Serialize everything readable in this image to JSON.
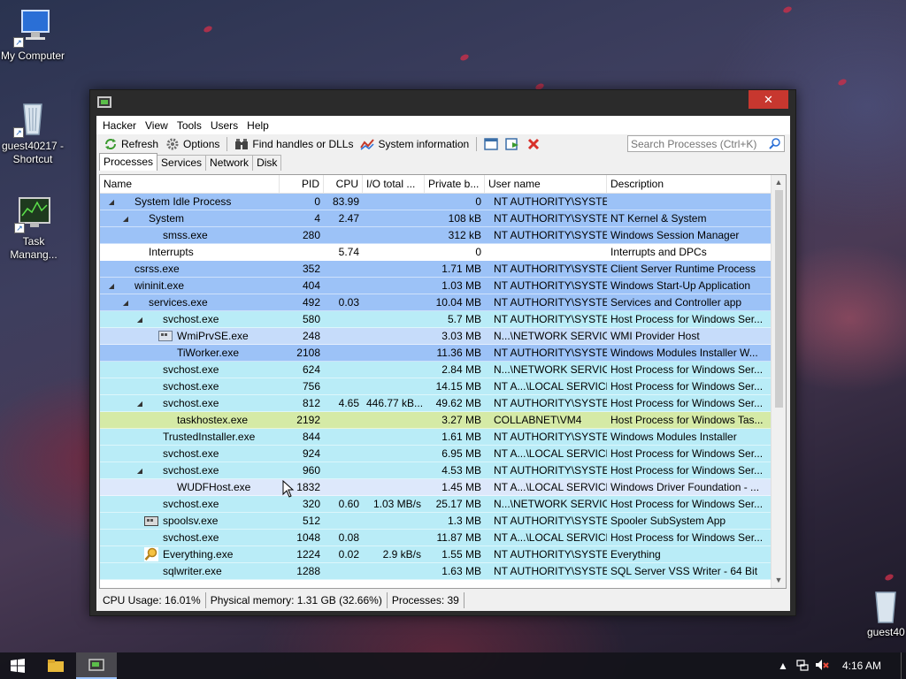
{
  "desktop": {
    "icons": [
      {
        "label": "My Computer"
      },
      {
        "label": "guest40217 - Shortcut"
      },
      {
        "label": "Task Manang..."
      },
      {
        "label": "guest40"
      }
    ]
  },
  "window": {
    "close_glyph": "✕",
    "menu": [
      "Hacker",
      "View",
      "Tools",
      "Users",
      "Help"
    ],
    "toolbar": {
      "refresh": "Refresh",
      "options": "Options",
      "find_handles": "Find handles or DLLs",
      "system_info": "System information",
      "search_placeholder": "Search Processes (Ctrl+K)"
    },
    "tabs": [
      "Processes",
      "Services",
      "Network",
      "Disk"
    ],
    "columns": {
      "name": "Name",
      "pid": "PID",
      "cpu": "CPU",
      "io": "I/O total ...",
      "private": "Private b...",
      "user": "User name",
      "description": "Description"
    },
    "processes": [
      {
        "name": "System Idle Process",
        "indent": 0,
        "expander": "◢",
        "icon": "window",
        "pid": "0",
        "cpu": "83.99",
        "io": "",
        "private": "0",
        "user": "NT AUTHORITY\\SYSTEM",
        "description": "",
        "color": "#9cc2f7"
      },
      {
        "name": "System",
        "indent": 1,
        "expander": "◢",
        "icon": "window",
        "pid": "4",
        "cpu": "2.47",
        "io": "",
        "private": "108 kB",
        "user": "NT AUTHORITY\\SYSTEM",
        "description": "NT Kernel & System",
        "color": "#9cc2f7"
      },
      {
        "name": "smss.exe",
        "indent": 2,
        "expander": "",
        "icon": "window",
        "pid": "280",
        "cpu": "",
        "io": "",
        "private": "312 kB",
        "user": "NT AUTHORITY\\SYSTEM",
        "description": "Windows Session Manager",
        "color": "#9cc2f7"
      },
      {
        "name": "Interrupts",
        "indent": 1,
        "expander": "",
        "icon": "window",
        "pid": "",
        "cpu": "5.74",
        "io": "",
        "private": "0",
        "user": "",
        "description": "Interrupts and DPCs",
        "color": "#ffffff"
      },
      {
        "name": "csrss.exe",
        "indent": 0,
        "expander": "",
        "icon": "window",
        "pid": "352",
        "cpu": "",
        "io": "",
        "private": "1.71 MB",
        "user": "NT AUTHORITY\\SYSTEM",
        "description": "Client Server Runtime Process",
        "color": "#9cc2f7"
      },
      {
        "name": "wininit.exe",
        "indent": 0,
        "expander": "◢",
        "icon": "window",
        "pid": "404",
        "cpu": "",
        "io": "",
        "private": "1.03 MB",
        "user": "NT AUTHORITY\\SYSTEM",
        "description": "Windows Start-Up Application",
        "color": "#9cc2f7"
      },
      {
        "name": "services.exe",
        "indent": 1,
        "expander": "◢",
        "icon": "window",
        "pid": "492",
        "cpu": "0.03",
        "io": "",
        "private": "10.04 MB",
        "user": "NT AUTHORITY\\SYSTEM",
        "description": "Services and Controller app",
        "color": "#9cc2f7"
      },
      {
        "name": "svchost.exe",
        "indent": 2,
        "expander": "◢",
        "icon": "window",
        "pid": "580",
        "cpu": "",
        "io": "",
        "private": "5.7 MB",
        "user": "NT AUTHORITY\\SYSTEM",
        "description": "Host Process for Windows Ser...",
        "color": "#b9ecf7"
      },
      {
        "name": "WmiPrvSE.exe",
        "indent": 3,
        "expander": "",
        "icon": "gear",
        "pid": "248",
        "cpu": "",
        "io": "",
        "private": "3.03 MB",
        "user": "N...\\NETWORK SERVICE",
        "description": "WMI Provider Host",
        "color": "#c6dcfa"
      },
      {
        "name": "TiWorker.exe",
        "indent": 3,
        "expander": "",
        "icon": "window",
        "pid": "2108",
        "cpu": "",
        "io": "",
        "private": "11.36 MB",
        "user": "NT AUTHORITY\\SYSTEM",
        "description": "Windows Modules Installer W...",
        "color": "#9cc2f7"
      },
      {
        "name": "svchost.exe",
        "indent": 2,
        "expander": "",
        "icon": "window",
        "pid": "624",
        "cpu": "",
        "io": "",
        "private": "2.84 MB",
        "user": "N...\\NETWORK SERVICE",
        "description": "Host Process for Windows Ser...",
        "color": "#b9ecf7"
      },
      {
        "name": "svchost.exe",
        "indent": 2,
        "expander": "",
        "icon": "window",
        "pid": "756",
        "cpu": "",
        "io": "",
        "private": "14.15 MB",
        "user": "NT A...\\LOCAL SERVICE",
        "description": "Host Process for Windows Ser...",
        "color": "#b9ecf7"
      },
      {
        "name": "svchost.exe",
        "indent": 2,
        "expander": "◢",
        "icon": "window",
        "pid": "812",
        "cpu": "4.65",
        "io": "446.77 kB...",
        "private": "49.62 MB",
        "user": "NT AUTHORITY\\SYSTEM",
        "description": "Host Process for Windows Ser...",
        "color": "#b9ecf7"
      },
      {
        "name": "taskhostex.exe",
        "indent": 3,
        "expander": "",
        "icon": "window",
        "pid": "2192",
        "cpu": "",
        "io": "",
        "private": "3.27 MB",
        "user": "COLLABNET\\VM4",
        "description": "Host Process for Windows Tas...",
        "color": "#d5eaa6"
      },
      {
        "name": "TrustedInstaller.exe",
        "indent": 2,
        "expander": "",
        "icon": "window",
        "pid": "844",
        "cpu": "",
        "io": "",
        "private": "1.61 MB",
        "user": "NT AUTHORITY\\SYSTEM",
        "description": "Windows Modules Installer",
        "color": "#b9ecf7"
      },
      {
        "name": "svchost.exe",
        "indent": 2,
        "expander": "",
        "icon": "window",
        "pid": "924",
        "cpu": "",
        "io": "",
        "private": "6.95 MB",
        "user": "NT A...\\LOCAL SERVICE",
        "description": "Host Process for Windows Ser...",
        "color": "#b9ecf7"
      },
      {
        "name": "svchost.exe",
        "indent": 2,
        "expander": "◢",
        "icon": "window",
        "pid": "960",
        "cpu": "",
        "io": "",
        "private": "4.53 MB",
        "user": "NT AUTHORITY\\SYSTEM",
        "description": "Host Process for Windows Ser...",
        "color": "#b9ecf7"
      },
      {
        "name": "WUDFHost.exe",
        "indent": 3,
        "expander": "",
        "icon": "window",
        "pid": "1832",
        "cpu": "",
        "io": "",
        "private": "1.45 MB",
        "user": "NT A...\\LOCAL SERVICE",
        "description": "Windows Driver Foundation - ...",
        "color": "#dde8fb"
      },
      {
        "name": "svchost.exe",
        "indent": 2,
        "expander": "",
        "icon": "window",
        "pid": "320",
        "cpu": "0.60",
        "io": "1.03 MB/s",
        "private": "25.17 MB",
        "user": "N...\\NETWORK SERVICE",
        "description": "Host Process for Windows Ser...",
        "color": "#b9ecf7"
      },
      {
        "name": "spoolsv.exe",
        "indent": 2,
        "expander": "",
        "icon": "printer",
        "pid": "512",
        "cpu": "",
        "io": "",
        "private": "1.3 MB",
        "user": "NT AUTHORITY\\SYSTEM",
        "description": "Spooler SubSystem App",
        "color": "#b9ecf7"
      },
      {
        "name": "svchost.exe",
        "indent": 2,
        "expander": "",
        "icon": "window",
        "pid": "1048",
        "cpu": "0.08",
        "io": "",
        "private": "11.87 MB",
        "user": "NT A...\\LOCAL SERVICE",
        "description": "Host Process for Windows Ser...",
        "color": "#b9ecf7"
      },
      {
        "name": "Everything.exe",
        "indent": 2,
        "expander": "",
        "icon": "search",
        "pid": "1224",
        "cpu": "0.02",
        "io": "2.9 kB/s",
        "private": "1.55 MB",
        "user": "NT AUTHORITY\\SYSTEM",
        "description": "Everything",
        "color": "#b9ecf7"
      },
      {
        "name": "sqlwriter.exe",
        "indent": 2,
        "expander": "",
        "icon": "window",
        "pid": "1288",
        "cpu": "",
        "io": "",
        "private": "1.63 MB",
        "user": "NT AUTHORITY\\SYSTEM",
        "description": "SQL Server VSS Writer - 64 Bit",
        "color": "#b9ecf7"
      }
    ],
    "status": {
      "cpu": "CPU Usage: 16.01%",
      "memory": "Physical memory: 1.31 GB (32.66%)",
      "processes": "Processes: 39"
    }
  },
  "taskbar": {
    "clock": "4:16 AM"
  }
}
